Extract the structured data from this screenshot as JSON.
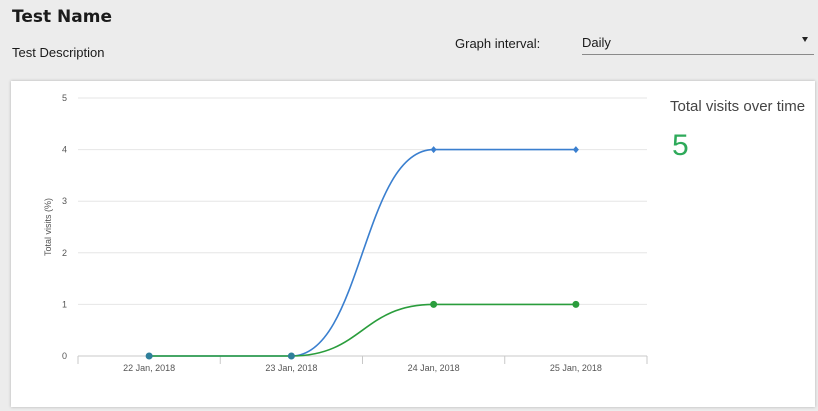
{
  "header": {
    "title": "Test Name",
    "description": "Test Description"
  },
  "controls": {
    "interval_label": "Graph interval:",
    "interval_value": "Daily"
  },
  "summary": {
    "title": "Total visits over time",
    "value": "5",
    "value_color": "#2eaa5a"
  },
  "chart_data": {
    "type": "line",
    "categories": [
      "22 Jan, 2018",
      "23 Jan, 2018",
      "24 Jan, 2018",
      "25 Jan, 2018"
    ],
    "series": [
      {
        "color": "#3a7fcf",
        "values": [
          0,
          0,
          4,
          4
        ]
      },
      {
        "color": "#2a9d3c",
        "values": [
          0,
          0,
          1,
          1
        ]
      }
    ],
    "xlabel": "",
    "ylabel": "Total visits (%)",
    "ylim": [
      0,
      5
    ],
    "yticks": [
      "0",
      "1",
      "2",
      "3",
      "4",
      "5"
    ],
    "grid": true,
    "smooth": true
  }
}
